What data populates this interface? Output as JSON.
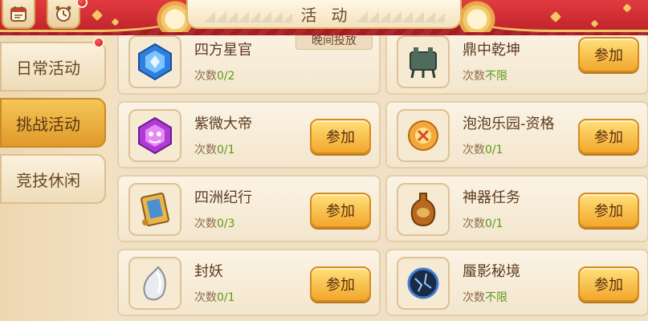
{
  "header": {
    "title": "活动",
    "icons": [
      "calendar-icon",
      "alarm-clock-icon"
    ]
  },
  "sidebar": {
    "items": [
      {
        "label": "日常活动",
        "active": false
      },
      {
        "label": "挑战活动",
        "active": true
      },
      {
        "label": "竞技休闲",
        "active": false
      }
    ]
  },
  "activities": {
    "left": [
      {
        "name": "四方星官",
        "count_label": "次数",
        "count": "0/2",
        "tag": "晚间投放",
        "icon": "blue-gem-icon"
      },
      {
        "name": "紫微大帝",
        "count_label": "次数",
        "count": "0/1",
        "button": "参加",
        "icon": "purple-gem-icon"
      },
      {
        "name": "四洲纪行",
        "count_label": "次数",
        "count": "0/3",
        "button": "参加",
        "icon": "scroll-book-icon"
      },
      {
        "name": "封妖",
        "count_label": "次数",
        "count": "0/1",
        "button": "参加",
        "icon": "white-crystal-icon"
      }
    ],
    "right": [
      {
        "name": "鼎中乾坤",
        "count_label": "次数",
        "count": "不限",
        "button": "参加",
        "icon": "bronze-cauldron-icon"
      },
      {
        "name": "泡泡乐园-资格",
        "count_label": "次数",
        "count": "0/1",
        "button": "参加",
        "icon": "golden-emblem-icon"
      },
      {
        "name": "神器任务",
        "count_label": "次数",
        "count": "0/1",
        "button": "参加",
        "icon": "gourd-vase-icon"
      },
      {
        "name": "蜃影秘境",
        "count_label": "次数",
        "count": "不限",
        "button": "参加",
        "icon": "dark-orb-icon"
      }
    ]
  },
  "colors": {
    "banner_red": "#c8232b",
    "button_gold": "#f2a72c",
    "active_tab": "#e09a2a",
    "count_green": "#5a9a1c",
    "text_brown": "#5d3b20"
  }
}
